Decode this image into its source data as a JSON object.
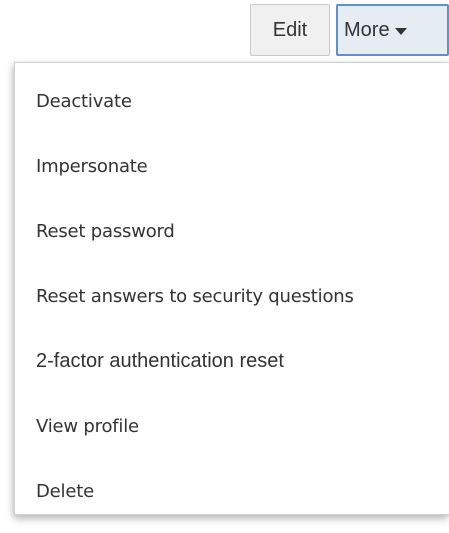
{
  "toolbar": {
    "edit_label": "Edit",
    "more_label": "More",
    "more_icon": "caret-down-icon"
  },
  "menu": {
    "items": [
      {
        "label": "Deactivate"
      },
      {
        "label": "Impersonate"
      },
      {
        "label": "Reset password"
      },
      {
        "label": "Reset answers to security questions"
      },
      {
        "label": "2-factor authentication reset"
      },
      {
        "label": "View profile"
      },
      {
        "label": "Delete"
      }
    ]
  },
  "colors": {
    "more_border": "#5e8fcf",
    "more_background": "#e5ecf3",
    "button_background": "#f0f0f0",
    "text": "#333333"
  }
}
